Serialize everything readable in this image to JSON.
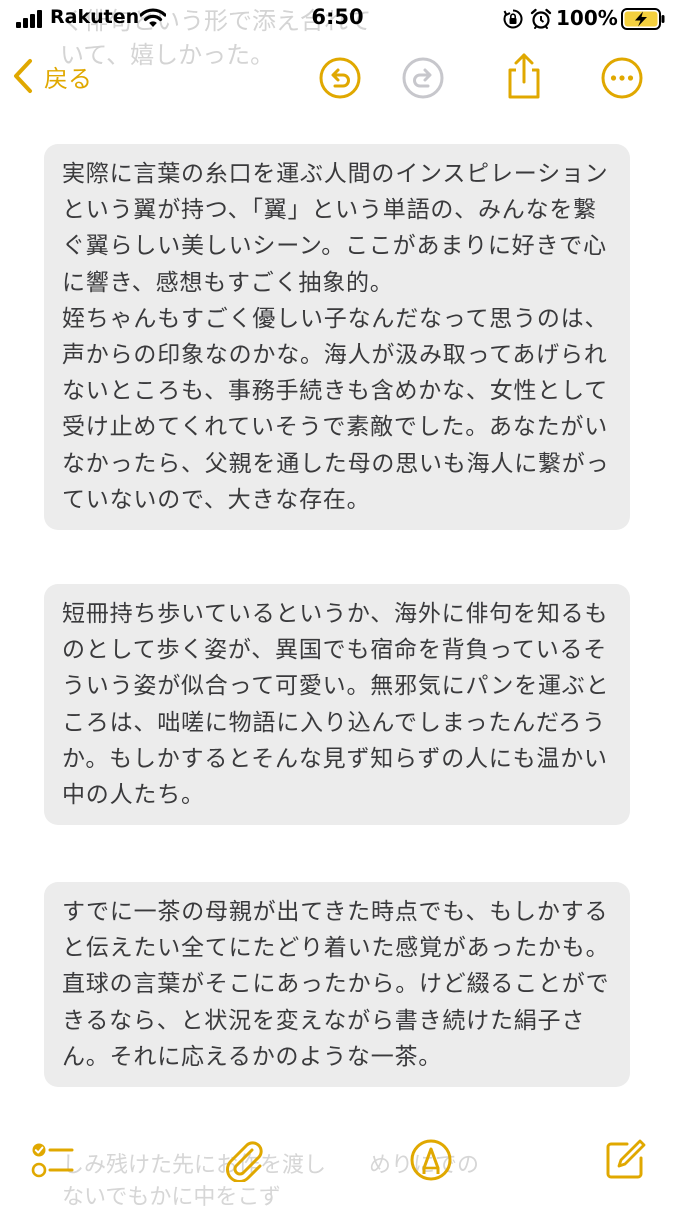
{
  "status_bar": {
    "carrier": "Rakuten",
    "time": "6:50",
    "battery_percent": "100%",
    "icons": [
      "signal-icon",
      "wifi-icon",
      "orientation-lock-icon",
      "alarm-icon",
      "battery-charging-icon"
    ]
  },
  "ghost_top": {
    "line1": "く俳句という形で添え合れて",
    "line2": "いて、嬉しかった。"
  },
  "nav": {
    "back_label": "戻る",
    "icons": [
      "chevron-left-icon",
      "undo-icon",
      "redo-icon",
      "share-icon",
      "more-icon"
    ]
  },
  "note": {
    "blocks": [
      {
        "paragraphs": [
          "実際に言葉の糸口を運ぶ人間のインスピレーションという翼が持つ、「翼」という単語の、みんなを繋ぐ翼らしい美しいシーン。ここがあまりに好きで心に響き、感想もすごく抽象的。",
          "姪ちゃんもすごく優しい子なんだなって思うのは、声からの印象なのかな。海人が汲み取ってあげられないところも、事務手続きも含めかな、女性として受け止めてくれていそうで素敵でした。あなたがいなかったら、父親を通した母の思いも海人に繋がっていないので、大きな存在。"
        ]
      },
      {
        "paragraphs": [
          "短冊持ち歩いているというか、海外に俳句を知るものとして歩く姿が、異国でも宿命を背負っているそういう姿が似合って可愛い。無邪気にパンを運ぶところは、咄嗟に物語に入り込んでしまったんだろうか。もしかするとそんな見ず知らずの人にも温かい中の人たち。"
        ]
      },
      {
        "paragraphs": [
          "すでに一茶の母親が出てきた時点でも、もしかすると伝えたい全てにたどり着いた感覚があったかも。直球の言葉がそこにあったから。けど綴ることができるなら、と状況を変えながら書き続けた絹子さん。それに応えるかのような一茶。"
        ]
      }
    ]
  },
  "ghost_bottom": {
    "line1": "しみ残けた先にお作を渡し",
    "line2": "めりにでの",
    "line3": "ないでもかに中をこず"
  },
  "toolbar": {
    "icons": [
      "checklist-icon",
      "attachment-icon",
      "markup-icon",
      "compose-icon"
    ]
  },
  "colors": {
    "accent": "#e0a800",
    "disabled": "#c7c7cc",
    "block_background": "#ececec",
    "battery_fill": "#f4d03f"
  }
}
